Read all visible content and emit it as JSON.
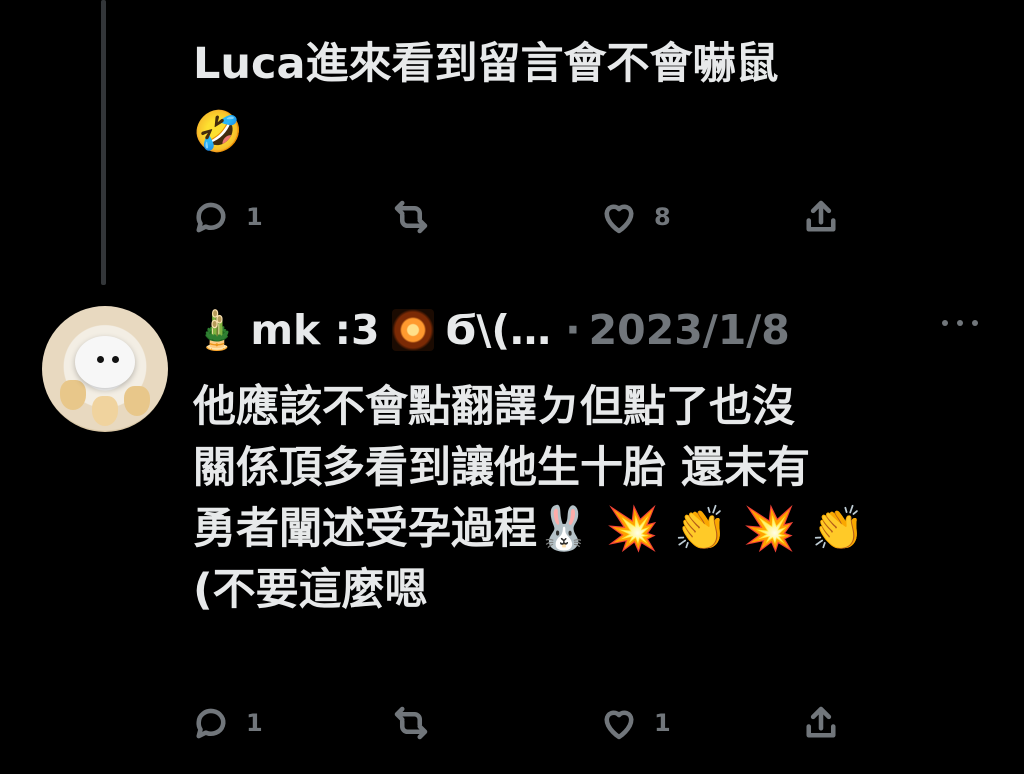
{
  "tweet1": {
    "text": "Luca進來看到留言會不會嚇鼠",
    "emoji": "🤣",
    "actions": {
      "replies": "1",
      "likes": "8"
    }
  },
  "tweet2": {
    "author": {
      "kadomatsu_emoji": "🎍",
      "name_part1": "mk :3",
      "name_part2": "Ϭ\\(…"
    },
    "dot": "·",
    "date": "2023/1/8",
    "lines": [
      "他應該不會點翻譯ㄉ但點了也沒",
      "關係頂多看到讓他生十胎 還未有",
      "勇者闡述受孕過程🐰 💥 👏 💥 👏",
      "(不要這麼嗯"
    ],
    "actions": {
      "replies": "1",
      "likes": "1"
    }
  },
  "icons": [
    "reply-icon",
    "retweet-icon",
    "like-icon",
    "share-icon",
    "more-icon",
    "sparkler-icon"
  ]
}
